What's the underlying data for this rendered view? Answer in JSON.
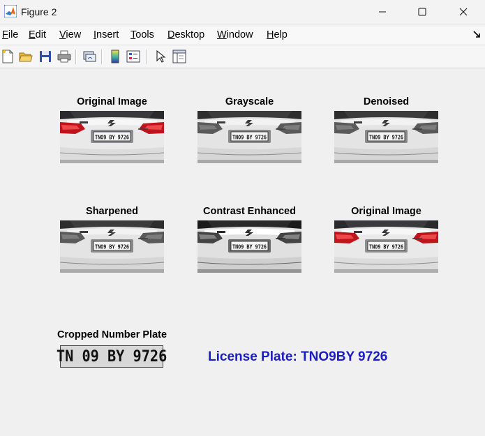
{
  "window": {
    "title": "Figure 2"
  },
  "menu": {
    "items": [
      {
        "underline": "F",
        "rest": "ile"
      },
      {
        "underline": "E",
        "rest": "dit"
      },
      {
        "underline": "V",
        "rest": "iew"
      },
      {
        "underline": "I",
        "rest": "nsert"
      },
      {
        "underline": "T",
        "rest": "ools"
      },
      {
        "underline": "D",
        "rest": "esktop"
      },
      {
        "underline": "W",
        "rest": "indow"
      },
      {
        "underline": "H",
        "rest": "elp"
      }
    ]
  },
  "toolbar": {
    "icons": [
      "new-figure-icon",
      "open-file-icon",
      "save-icon",
      "print-icon",
      "link-plot-icon",
      "colorbar-icon",
      "legend-icon",
      "select-arrow-icon",
      "property-inspector-icon"
    ]
  },
  "panels": [
    {
      "title": "Original Image",
      "variant": "original"
    },
    {
      "title": "Grayscale",
      "variant": "gray"
    },
    {
      "title": "Denoised",
      "variant": "gray"
    },
    {
      "title": "Sharpened",
      "variant": "gray"
    },
    {
      "title": "Contrast Enhanced",
      "variant": "contrast"
    },
    {
      "title": "Original Image",
      "variant": "original"
    }
  ],
  "plate_text": "TNO9 BY 9726",
  "cropped": {
    "title": "Cropped Number Plate",
    "plate_text": "TN 09 BY 9726"
  },
  "result": {
    "text": "License Plate: TNO9BY 9726"
  },
  "colors": {
    "result_text": "#1c1cc4",
    "taillight": "#c0141c"
  }
}
